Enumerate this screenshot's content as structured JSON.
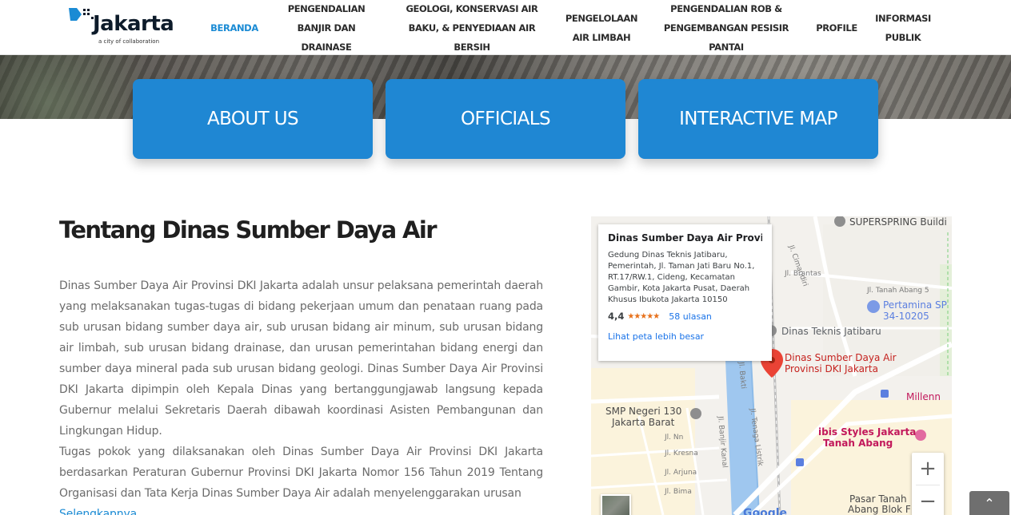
{
  "brand": {
    "logo_text": "Jakarta",
    "tagline": "a city of collaboration",
    "accent": "#1b8bd4"
  },
  "nav": {
    "items": [
      {
        "label": "BERANDA",
        "active": true
      },
      {
        "label": "PENGENDALIAN BANJIR DAN DRAINASE"
      },
      {
        "label": "GEOLOGI, KONSERVASI AIR BAKU, & PENYEDIAAN AIR BERSIH"
      },
      {
        "label": "PENGELOLAAN AIR LIMBAH"
      },
      {
        "label": "PENGENDALIAN ROB & PENGEMBANGAN PESISIR PANTAI"
      },
      {
        "label": "PROFILE"
      },
      {
        "label": "INFORMASI PUBLIK"
      }
    ]
  },
  "cards": {
    "about": "ABOUT US",
    "officials": "OFFICIALS",
    "map": "INTERACTIVE MAP",
    "color": "#1f87d3"
  },
  "article": {
    "title": "Tentang Dinas Sumber Daya Air",
    "paragraph1": "Dinas Sumber Daya Air Provinsi DKI Jakarta adalah unsur pelaksana pemerintah daerah yang melaksanakan tugas-tugas di bidang pekerjaan umum dan penataan ruang pada sub urusan bidang sumber daya air, sub urusan bidang air minum, sub urusan bidang air limbah, sub urusan bidang drainase, dan urusan pemerintahan bidang energi dan sumber daya mineral pada sub urusan bidang geologi. Dinas Sumber Daya Air Provinsi DKI Jakarta dipimpin oleh Kepala Dinas yang bertanggungjawab langsung kepada Gubernur melalui Sekretaris Daerah dibawah koordinasi Asisten Pembangunan dan Lingkungan Hidup.",
    "paragraph2": "Tugas pokok yang dilaksanakan oleh Dinas Sumber Daya Air Provinsi DKI Jakarta berdasarkan Peraturan Gubernur Provinsi DKI Jakarta Nomor 156 Tahun 2019 Tentang Organisasi dan Tata Kerja Dinas Sumber Daya Air adalah menyelenggarakan urusan",
    "more_link": "Selengkapnya"
  },
  "map": {
    "place_name": "Dinas Sumber Daya Air Provin...",
    "address": "Gedung Dinas Teknis Jatibaru, Pemerintah, Jl. Taman Jati Baru No.1, RT.17/RW.1, Cideng, Kecamatan Gambir, Kota Jakarta Pusat, Daerah Khusus Ibukota Jakarta 10150",
    "rating": "4,4",
    "rating_value": 4.4,
    "stars": "★★★★★",
    "reviews": "58 ulasan",
    "larger_map": "Lihat peta lebih besar",
    "marker_label_1": "Dinas Sumber Daya Air",
    "marker_label_2": "Provinsi DKI Jakarta",
    "poi_dinas_teknis": "Dinas Teknis Jatibaru",
    "poi_superspring": "SUPERSPRING Buildi",
    "poi_pertamina_1": "Pertamina SP",
    "poi_pertamina_2": "34-10205",
    "poi_smp_1": "SMP Negeri 130",
    "poi_smp_2": "Jakarta Barat",
    "poi_ibis_1": "ibis Styles Jakarta",
    "poi_ibis_2": "Tanah Abang",
    "poi_millennium": "Millenn",
    "poi_pasar_1": "Pasar Tanah",
    "poi_pasar_2": "Abang Blok F",
    "street_cimandiri": "Jl. Cimandiri",
    "street_brantas": "Jl. Brantas",
    "street_tanah_abang": "Jl. Tanah Abang 5",
    "street_bakti": "Jl. Bakti",
    "street_banjir_kanal": "Jl. Banjir Kanal",
    "street_tenaga_listrik": "Jl. Tenaga Listrik",
    "street_kresna": "Jl. Kresna",
    "street_arjuna": "Jl. Arjuna",
    "street_bima": "Jl. Bima",
    "street_nn": "Jl. Nn",
    "zoom_in": "+",
    "zoom_out": "−",
    "google_logo": "Google"
  },
  "ui": {
    "back_to_top": "⌃"
  }
}
